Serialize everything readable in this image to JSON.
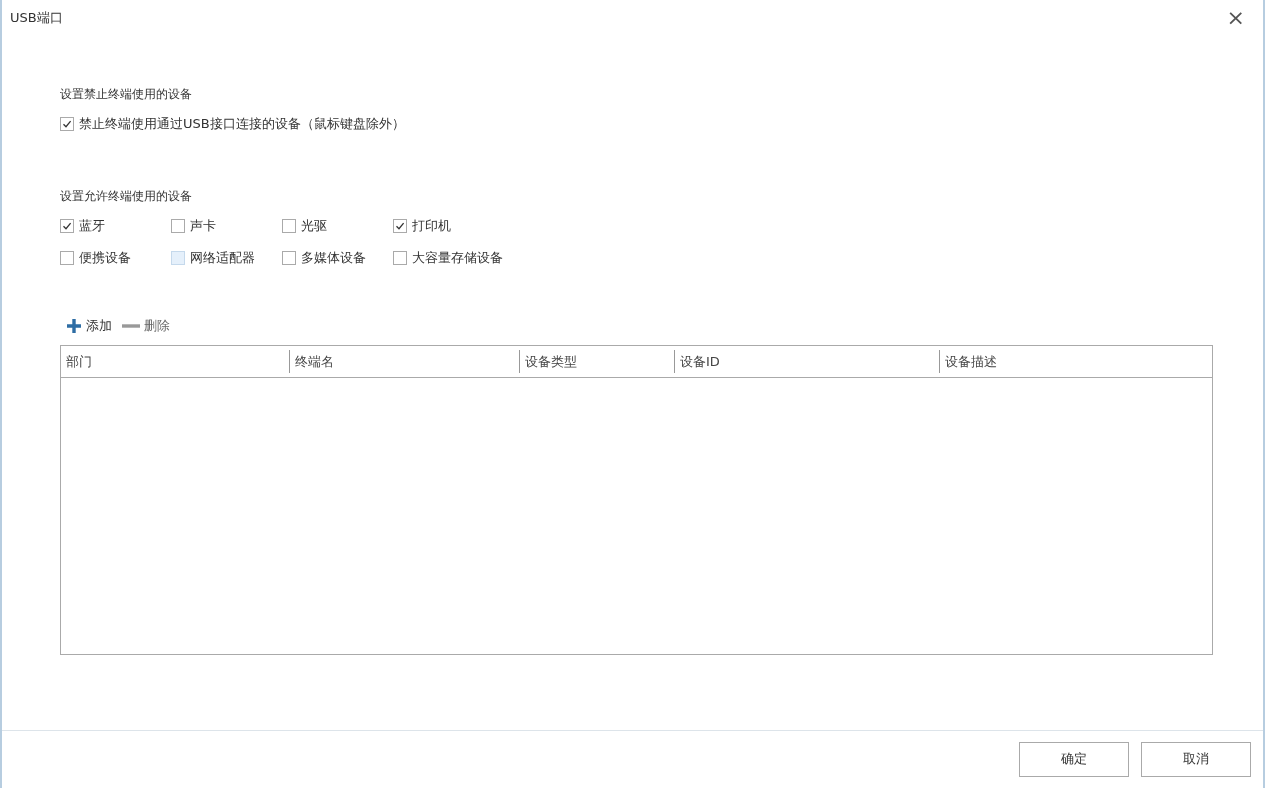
{
  "window": {
    "title": "USB端口",
    "close": "×"
  },
  "deny_section": {
    "heading": "设置禁止终端使用的设备",
    "options": [
      {
        "label": "禁止终端使用通过USB接口连接的设备（鼠标键盘除外）",
        "checked": true,
        "hovered": false
      }
    ]
  },
  "allow_section": {
    "heading": "设置允许终端使用的设备",
    "options": [
      {
        "label": "蓝牙",
        "checked": true,
        "hovered": false
      },
      {
        "label": "声卡",
        "checked": false,
        "hovered": false
      },
      {
        "label": "光驱",
        "checked": false,
        "hovered": false
      },
      {
        "label": "打印机",
        "checked": true,
        "hovered": false
      },
      {
        "label": "便携设备",
        "checked": false,
        "hovered": false
      },
      {
        "label": "网络适配器",
        "checked": false,
        "hovered": true
      },
      {
        "label": "多媒体设备",
        "checked": false,
        "hovered": false
      },
      {
        "label": "大容量存储设备",
        "checked": false,
        "hovered": false
      }
    ]
  },
  "toolbar": [
    {
      "kind": "add",
      "label": "添加"
    },
    {
      "kind": "remove",
      "label": "删除"
    }
  ],
  "table": {
    "columns": [
      "部门",
      "终端名",
      "设备类型",
      "设备ID",
      "设备描述"
    ]
  },
  "buttons": [
    "确定",
    "取消"
  ]
}
